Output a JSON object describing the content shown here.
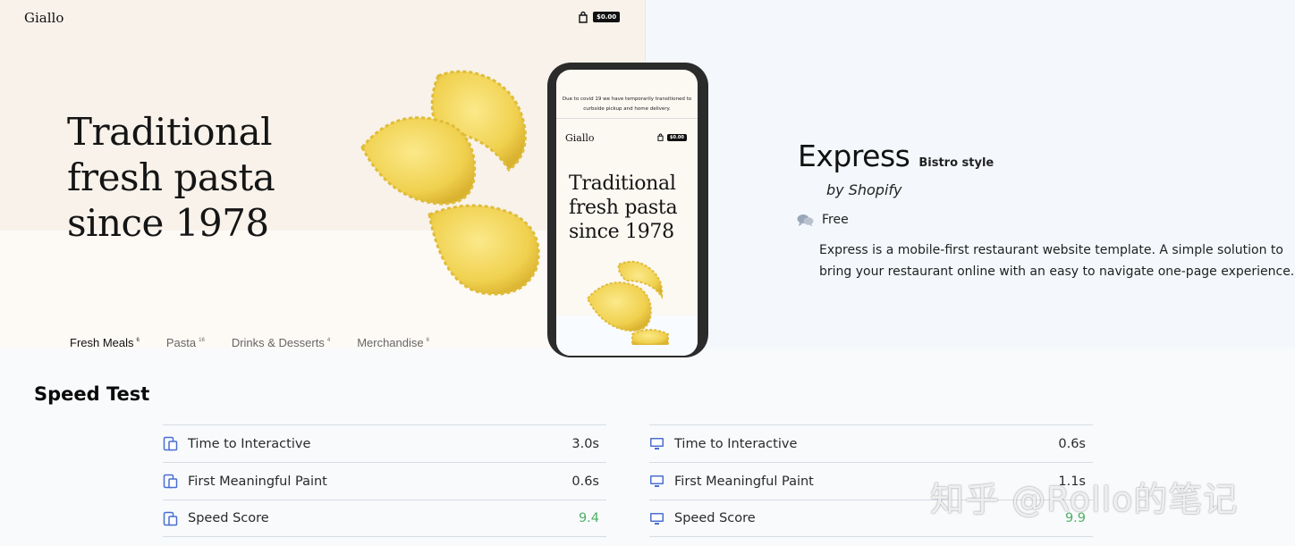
{
  "desktop_preview": {
    "brand": "Giallo",
    "cart_price": "$0.00",
    "headline": [
      "Traditional",
      "fresh pasta",
      "since 1978"
    ],
    "nav": [
      {
        "label": "Fresh Meals",
        "count": "6"
      },
      {
        "label": "Pasta",
        "count": "16"
      },
      {
        "label": "Drinks & Desserts",
        "count": "4"
      },
      {
        "label": "Merchandise",
        "count": "6"
      }
    ]
  },
  "mobile_preview": {
    "notice": "Due to covid 19 we have temporarily transitioned to curbside pickup and home delivery.",
    "brand": "Giallo",
    "cart_price": "$0.00",
    "headline": [
      "Traditional",
      "fresh pasta",
      "since 1978"
    ]
  },
  "theme": {
    "name": "Express",
    "style": "Bistro style",
    "author": "by Shopify",
    "price": "Free",
    "description": "Express is a mobile-first restaurant website template. A simple solution to bring your restaurant online with an easy to navigate one-page experience."
  },
  "speed_test": {
    "title": "Speed Test",
    "mobile": [
      {
        "label": "Time to Interactive",
        "value": "3.0s"
      },
      {
        "label": "First Meaningful Paint",
        "value": "0.6s"
      },
      {
        "label": "Speed Score",
        "value": "9.4"
      }
    ],
    "desktop": [
      {
        "label": "Time to Interactive",
        "value": "0.6s"
      },
      {
        "label": "First Meaningful Paint",
        "value": "1.1s"
      },
      {
        "label": "Speed Score",
        "value": "9.9"
      }
    ]
  },
  "watermark": "知乎 @Rollo的笔记",
  "colors": {
    "score_good": "#4fb064",
    "icon_blue": "#4a6fd0",
    "pasta": "#f1d75a"
  }
}
